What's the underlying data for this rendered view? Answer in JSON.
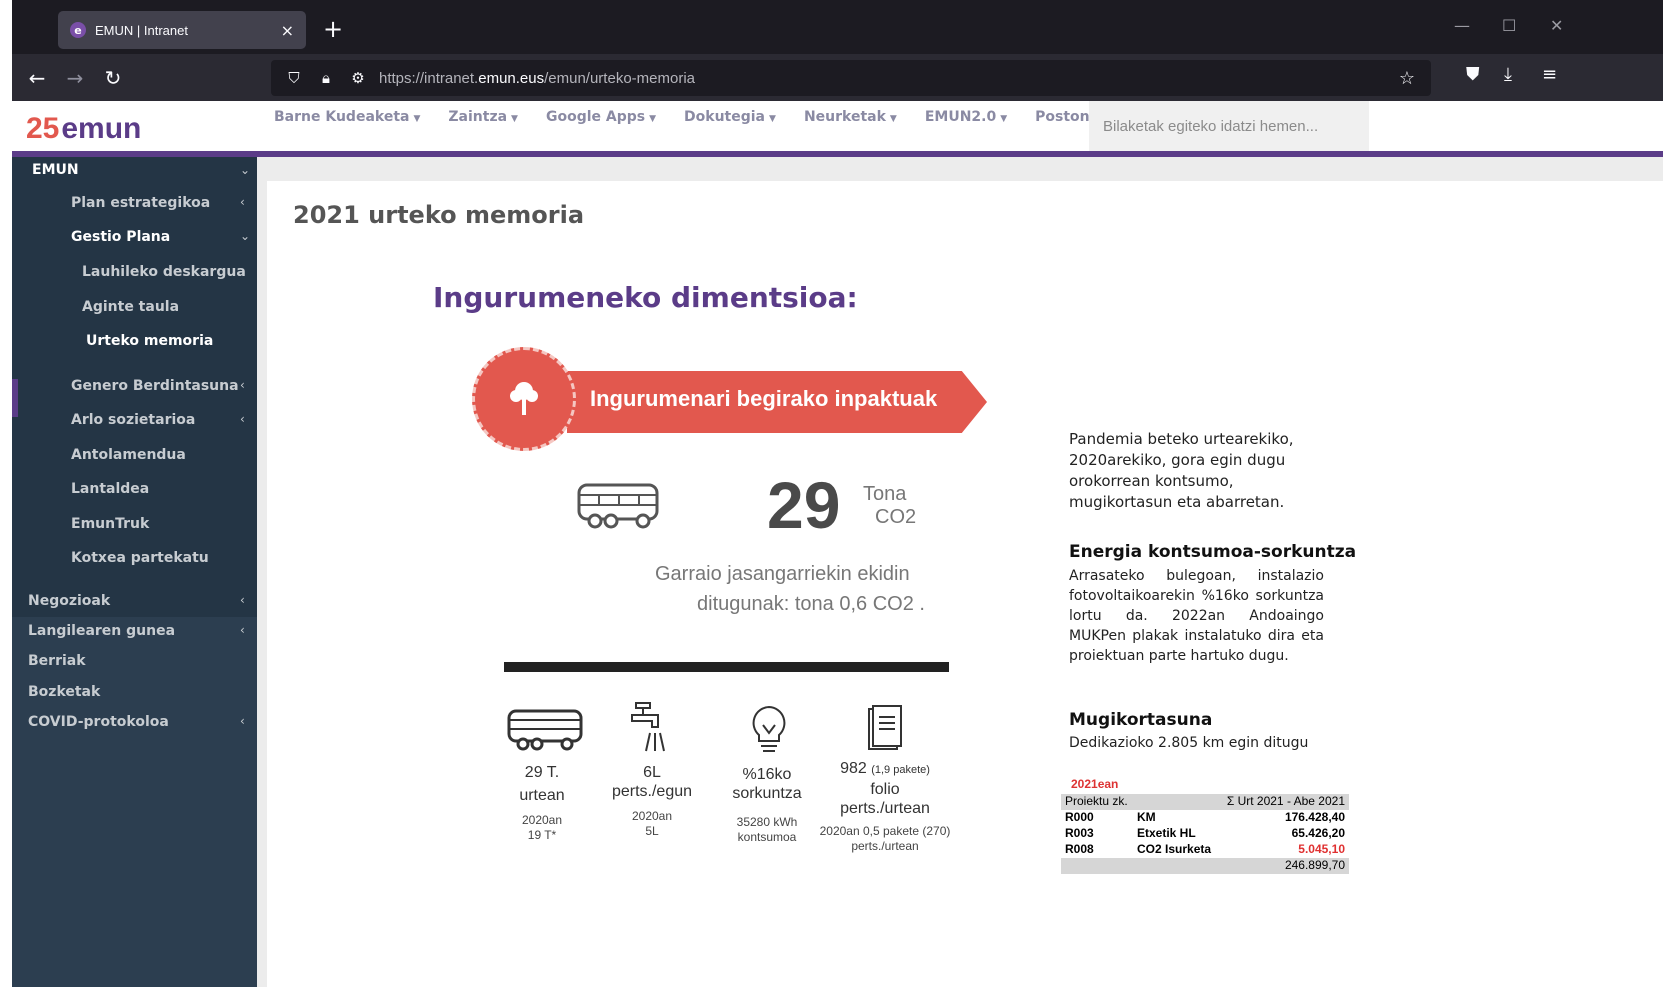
{
  "browser": {
    "tab_title": "EMUN | Intranet",
    "tab_close": "×",
    "new_tab": "+",
    "url_host": "https://intranet.",
    "url_domain": "emun.eus",
    "url_path": "/emun/urteko-memoria"
  },
  "header": {
    "logo_number": "25",
    "logo_name": "emun",
    "menu": [
      {
        "label": "Barne Kudeaketa"
      },
      {
        "label": "Zaintza"
      },
      {
        "label": "Google Apps"
      },
      {
        "label": "Dokutegia"
      },
      {
        "label": "Neurketak"
      },
      {
        "label": "EMUN2.0"
      },
      {
        "label": "Postontzia"
      }
    ],
    "search_placeholder": "Bilaketak egiteko idatzi hemen..."
  },
  "sidebar": {
    "top": "EMUN",
    "items": [
      {
        "label": "Plan estrategikoa"
      },
      {
        "label": "Gestio Plana"
      },
      {
        "label": "Lauhileko deskargua"
      },
      {
        "label": "Aginte taula"
      },
      {
        "label": "Urteko memoria"
      },
      {
        "label": "Genero Berdintasuna"
      },
      {
        "label": "Arlo sozietarioa"
      },
      {
        "label": "Antolamendua"
      },
      {
        "label": "Lantaldea"
      },
      {
        "label": "EmunTruk"
      },
      {
        "label": "Kotxea partekatu"
      }
    ],
    "bottom": [
      {
        "label": "Negozioak"
      },
      {
        "label": "Langilearen gunea"
      },
      {
        "label": "Berriak"
      },
      {
        "label": "Bozketak"
      },
      {
        "label": "COVID-protokoloa"
      }
    ]
  },
  "main": {
    "title": "2021 urteko memoria",
    "section_title": "Ingurumeneko dimentsioa:",
    "ribbon": "Ingurumenari begirako inpaktuak",
    "big_value": "29",
    "big_unit1": "Tona",
    "big_unit2": "CO2",
    "garraio1": "Garraio jasangarriekin ekidin",
    "garraio2": "ditugunak: tona 0,6 CO2 .",
    "stats": [
      {
        "a1": "29 T.",
        "a2": "urtean",
        "b1": "2020an",
        "b2": "19 T*"
      },
      {
        "a1": "6L",
        "a2": "perts./egun",
        "b1": "2020an",
        "b2": "5L"
      },
      {
        "a1": "%16ko",
        "a2": "sorkuntza",
        "b1": "35280 kWh",
        "b2": "kontsumoa"
      },
      {
        "a1": "982",
        "a1s": "(1,9 pakete)",
        "a2": "folio",
        "a3": "perts./urtean",
        "b1": "2020an 0,5 pakete (270)",
        "b2": "perts./urtean"
      }
    ],
    "right_intro": [
      "Pandemia beteko urtearekiko,",
      "2020arekiko, gora egin dugu",
      "orokorrean kontsumo,",
      "mugikortasun eta abarretan."
    ],
    "energy_title": "Energia kontsumoa-sorkuntza",
    "energy_text": "Arrasateko bulegoan, instalazio fotovoltaikoarekin %16ko sorkuntza lortu da. 2022an Andoaingo MUKPen plakak instalatuko dira eta proiektuan parte hartuko dugu.",
    "mobility_title": "Mugikortasuna",
    "mobility_text": "Dedikazioko 2.805 km egin ditugu",
    "table": {
      "year": "2021ean",
      "header_left": "Proiektu zk.",
      "header_right": "Σ Urt 2021 - Abe 2021",
      "rows": [
        {
          "code": "R000",
          "name": "KM",
          "value": "176.428,40"
        },
        {
          "code": "R003",
          "name": "Etxetik HL",
          "value": "65.426,20"
        },
        {
          "code": "R008",
          "name": "CO2 Isurketa",
          "value": "5.045,10"
        }
      ],
      "total": "246.899,70"
    }
  }
}
